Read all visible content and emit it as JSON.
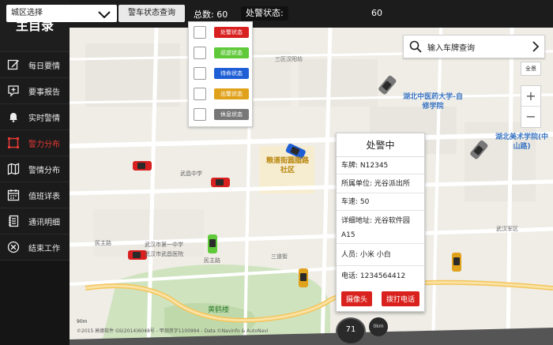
{
  "sidebar": {
    "title": "主目录",
    "items": [
      {
        "label": "每日要情",
        "icon": "edit-icon"
      },
      {
        "label": "要事报告",
        "icon": "report-icon"
      },
      {
        "label": "实时警情",
        "icon": "bell-icon"
      },
      {
        "label": "警力分布",
        "icon": "crop-icon"
      },
      {
        "label": "警情分布",
        "icon": "map-icon"
      },
      {
        "label": "值班详表",
        "icon": "calendar-icon"
      },
      {
        "label": "通讯明细",
        "icon": "notebook-icon"
      },
      {
        "label": "结束工作",
        "icon": "close-circle-icon"
      }
    ],
    "active_index": 3
  },
  "topbar": {
    "district_select": "城区选择",
    "status_query": "警车状态查询",
    "total_label": "总数:",
    "total_value": "60",
    "alert_label": "处警状态:",
    "alert_value": "60"
  },
  "status_filters": [
    {
      "label": "处警状态",
      "color": "#d92020"
    },
    {
      "label": "巡逻状态",
      "color": "#5fc93a"
    },
    {
      "label": "待命状态",
      "color": "#1e5fd6"
    },
    {
      "label": "出警状态",
      "color": "#e0a11b"
    },
    {
      "label": "休息状态",
      "color": "#777777"
    }
  ],
  "search": {
    "placeholder": "输入车牌查询"
  },
  "map_controls": {
    "panorama": "全景",
    "zoom_in": "+",
    "zoom_out": "−"
  },
  "info_card": {
    "status": "处警中",
    "plate_label": "车牌:",
    "plate": "N12345",
    "unit_label": "所属单位:",
    "unit": "光谷派出所",
    "speed_label": "车速:",
    "speed": "50",
    "address_label": "详细地址:",
    "address": "光谷软件园A15",
    "person_label": "人员:",
    "person": "小米 小白",
    "phone_label": "电话:",
    "phone": "1234564412",
    "camera_button": "摄像头",
    "call_button": "拨打电话"
  },
  "map_labels": {
    "hospital": "湖北中医药大学-自修学院",
    "art_school": "湖北美术学院(中山路)",
    "community": "粮道街圆脂路社区",
    "yellow_crane": "黄鹤楼",
    "road1": "民主路",
    "road2": "三道街",
    "road3": "民主路",
    "poi1": "武昌中学",
    "poi2": "武汉市第一中学",
    "poi3": "武汉市武昌医院",
    "poi4": "武汉军区",
    "poi5": "三区汉阳坊"
  },
  "speedometer": {
    "value": "71",
    "small": "0km"
  },
  "scale_label": "90m",
  "copyright": "©2015 高德软件 GS(2014)6048号 - 甲测资字1100994 - Data ©Navinfo & AutoNavi"
}
